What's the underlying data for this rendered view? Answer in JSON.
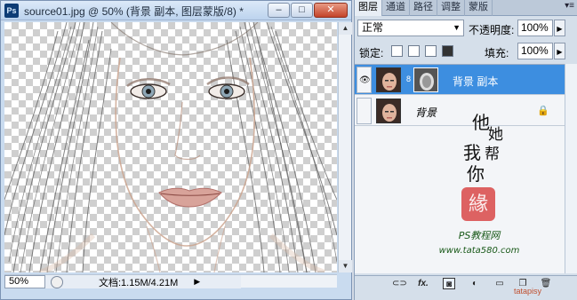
{
  "document": {
    "app_icon_text": "Ps",
    "title": "source01.jpg @ 50% (背景 副本, 图层蒙版/8) *",
    "zoom": "50%",
    "doc_info": "文档:1.15M/4.21M",
    "window_buttons": {
      "minimize": "–",
      "maximize": "□",
      "close": "✕"
    }
  },
  "panel": {
    "tabs": [
      "图层",
      "通道",
      "路径",
      "调整",
      "蒙版"
    ],
    "active_tab": 0,
    "blend_mode": "正常",
    "opacity_label": "不透明度:",
    "opacity_value": "100%",
    "lock_label": "锁定:",
    "fill_label": "填充:",
    "fill_value": "100%",
    "layers": [
      {
        "name": "背景 副本",
        "selected": true,
        "visible": true,
        "has_mask": true
      },
      {
        "name": "背景",
        "selected": false,
        "visible": false,
        "locked": true
      }
    ],
    "watermark": {
      "calligraphy": [
        "他",
        "她",
        "我",
        "帮",
        "你"
      ],
      "seal": "緣",
      "site_name": "PS教程网",
      "site_url": "www.tata580.com"
    },
    "bottom_icons": [
      "link-icon",
      "fx-icon",
      "add-mask-icon",
      "adjustment-icon",
      "folder-icon",
      "new-layer-icon",
      "trash-icon"
    ],
    "fx_label": "fx."
  },
  "corner_watermark": "tatapisy"
}
